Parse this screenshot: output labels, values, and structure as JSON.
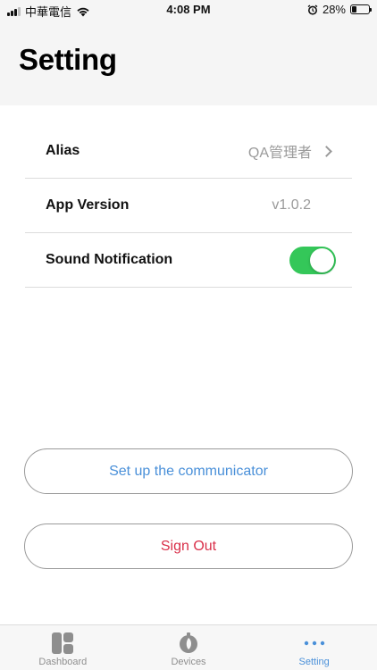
{
  "status_bar": {
    "carrier": "中華電信",
    "time": "4:08 PM",
    "battery": "28%",
    "battery_level": 0.28,
    "icons": [
      "signal-icon",
      "wifi-icon",
      "alarm-icon",
      "battery-icon"
    ]
  },
  "header": {
    "title": "Setting"
  },
  "settings": {
    "alias_label": "Alias",
    "alias_value": "QA管理者",
    "version_label": "App Version",
    "version_value": "v1.0.2",
    "sound_label": "Sound Notification",
    "sound_enabled": true
  },
  "actions": {
    "setup_label": "Set up the communicator",
    "signout_label": "Sign Out"
  },
  "tab_bar": {
    "tabs": [
      {
        "label": "Dashboard",
        "icon": "dashboard-icon",
        "active": false
      },
      {
        "label": "Devices",
        "icon": "devices-icon",
        "active": false
      },
      {
        "label": "Setting",
        "icon": "more-dots-icon",
        "active": true
      }
    ]
  },
  "colors": {
    "accent": "#4a90d9",
    "toggle_on": "#34c759",
    "danger": "#d9304a"
  }
}
